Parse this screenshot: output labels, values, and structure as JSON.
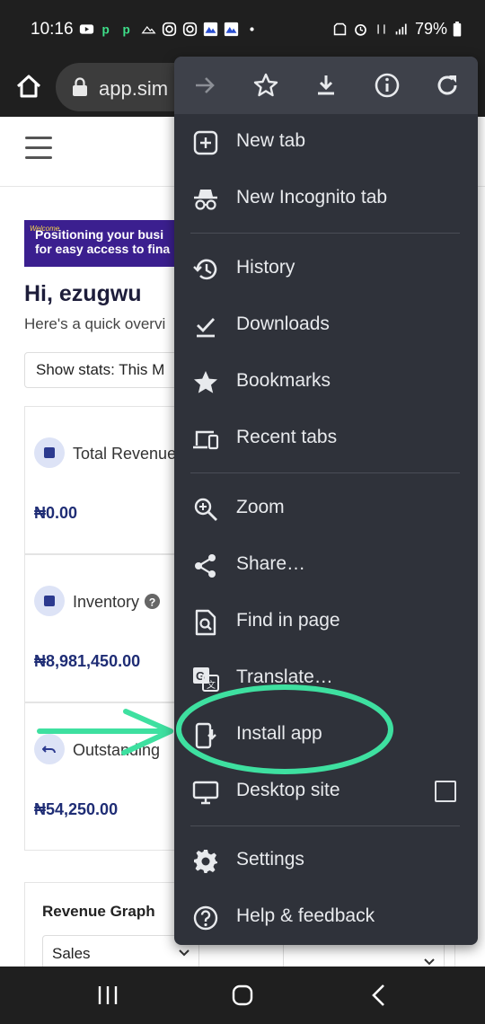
{
  "status_bar": {
    "time": "10:16",
    "battery": "79%"
  },
  "toolbar": {
    "url": "app.sim"
  },
  "page": {
    "banner_tag": "Welcome",
    "banner_line1": "Positioning your busi",
    "banner_line2": "for easy access to fina",
    "greeting": "Hi, ezugwu",
    "overview": "Here's a quick overvi",
    "stats_select": "Show stats: This M",
    "cards": [
      {
        "title": "Total Revenue",
        "value": "₦0.00"
      },
      {
        "title": "Inventory",
        "value": "₦8,981,450.00"
      },
      {
        "title": "Outstanding",
        "value": "₦54,250.00"
      }
    ],
    "graph_title": "Revenue Graph",
    "graph_select": "Sales"
  },
  "menu": {
    "items": [
      {
        "label": "New tab",
        "icon": "new-tab-icon"
      },
      {
        "label": "New Incognito tab",
        "icon": "incognito-icon"
      },
      {
        "label": "History",
        "icon": "history-icon"
      },
      {
        "label": "Downloads",
        "icon": "downloads-icon"
      },
      {
        "label": "Bookmarks",
        "icon": "star-icon"
      },
      {
        "label": "Recent tabs",
        "icon": "devices-icon"
      },
      {
        "label": "Zoom",
        "icon": "zoom-icon"
      },
      {
        "label": "Share…",
        "icon": "share-icon"
      },
      {
        "label": "Find in page",
        "icon": "find-icon"
      },
      {
        "label": "Translate…",
        "icon": "translate-icon"
      },
      {
        "label": "Install app",
        "icon": "install-app-icon"
      },
      {
        "label": "Desktop site",
        "icon": "desktop-icon"
      },
      {
        "label": "Settings",
        "icon": "gear-icon"
      },
      {
        "label": "Help & feedback",
        "icon": "help-icon"
      }
    ]
  },
  "colors": {
    "menu_bg": "#2f323a",
    "highlight": "#3ee0a0",
    "bar": "#1f1f1f"
  }
}
